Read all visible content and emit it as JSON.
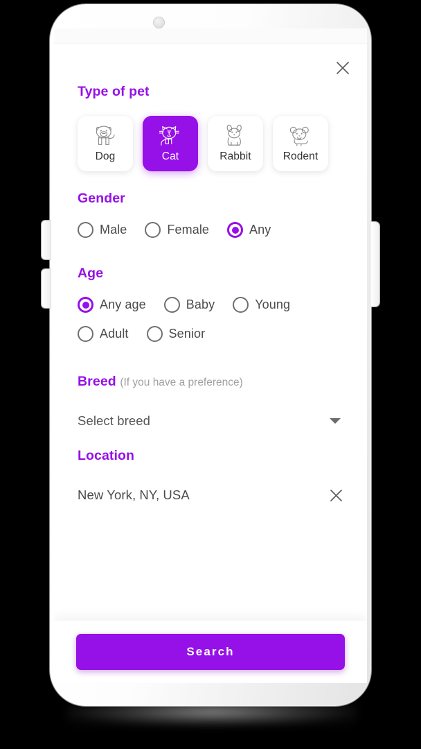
{
  "screen": {
    "close_icon": "close-icon"
  },
  "pet_type": {
    "title": "Type of pet",
    "options": [
      {
        "label": "Dog",
        "icon": "dog-icon",
        "selected": false
      },
      {
        "label": "Cat",
        "icon": "cat-icon",
        "selected": true
      },
      {
        "label": "Rabbit",
        "icon": "rabbit-icon",
        "selected": false
      },
      {
        "label": "Rodent",
        "icon": "rodent-icon",
        "selected": false
      }
    ]
  },
  "gender": {
    "title": "Gender",
    "options": [
      {
        "label": "Male",
        "selected": false
      },
      {
        "label": "Female",
        "selected": false
      },
      {
        "label": "Any",
        "selected": true
      }
    ]
  },
  "age": {
    "title": "Age",
    "options": [
      {
        "label": "Any age",
        "selected": true
      },
      {
        "label": "Baby",
        "selected": false
      },
      {
        "label": "Young",
        "selected": false
      },
      {
        "label": "Adult",
        "selected": false
      },
      {
        "label": "Senior",
        "selected": false
      }
    ]
  },
  "breed": {
    "title": "Breed",
    "hint": "(If you have a preference)",
    "value": "Select breed",
    "caret_icon": "chevron-down-icon"
  },
  "location": {
    "title": "Location",
    "value": "New York, NY, USA",
    "clear_icon": "close-icon"
  },
  "footer": {
    "search_label": "Search"
  },
  "colors": {
    "accent": "#9610E8",
    "text": "#4a4a4a",
    "muted": "#a0a0a0",
    "screen_bg": "#ffffff"
  }
}
